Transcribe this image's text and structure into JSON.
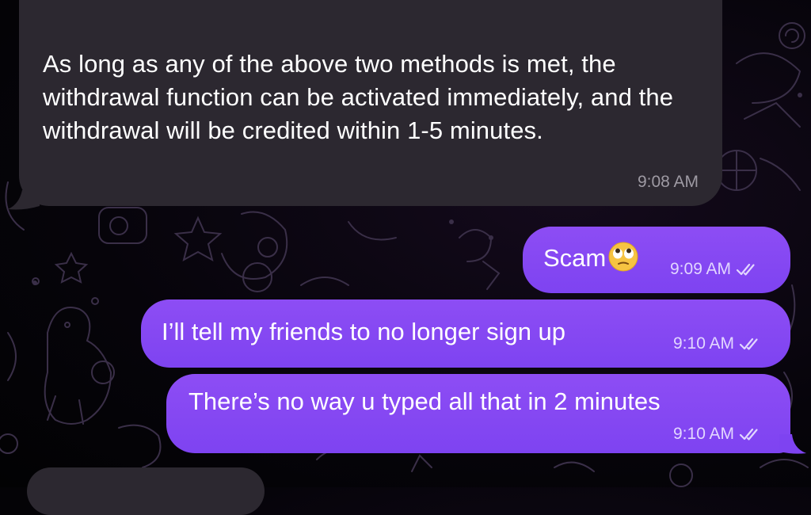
{
  "conversation": {
    "incoming_message": {
      "text": "As long as any of the above two methods is met, the withdrawal function can be activated immediately, and the withdrawal will be credited within 1-5 minutes.",
      "time": "9:08 AM"
    },
    "outgoing_messages": [
      {
        "text": "Scam",
        "emoji": "face-with-rolling-eyes-emoji",
        "time": "9:09 AM",
        "status": "read"
      },
      {
        "text": "I’ll tell my friends to no longer sign up",
        "time": "9:10 AM",
        "status": "read"
      },
      {
        "text": "There’s no way u typed all that in 2 minutes",
        "time": "9:10 AM",
        "status": "read"
      }
    ]
  },
  "colors": {
    "outgoing_bubble": "#8d4df4",
    "incoming_bubble": "#2c2830",
    "background": "#06040a",
    "timestamp_incoming": "#9e9aa3",
    "timestamp_outgoing": "#e2d6ff"
  }
}
